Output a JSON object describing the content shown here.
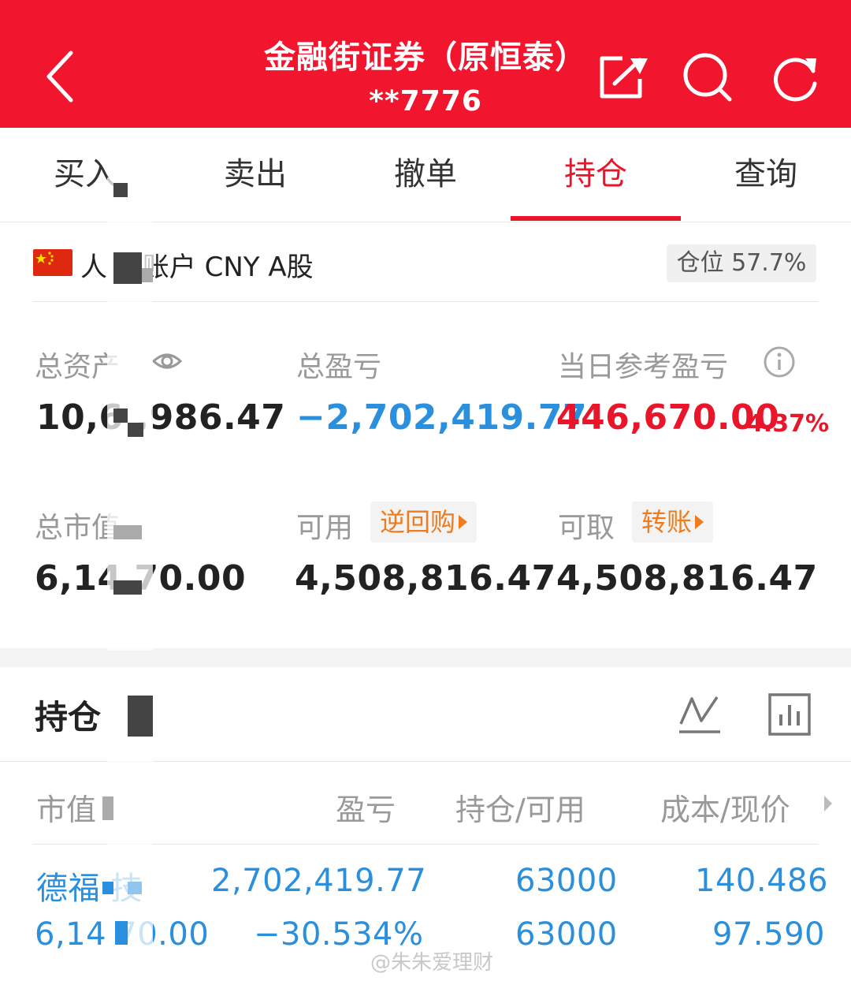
{
  "header": {
    "title": "金融街证券（原恒泰）",
    "account": "**7776"
  },
  "tabs": [
    {
      "label": "买入"
    },
    {
      "label": "卖出"
    },
    {
      "label": "撤单"
    },
    {
      "label": "持仓"
    },
    {
      "label": "查询"
    }
  ],
  "account_row": {
    "name": "人  币账户 CNY A股",
    "position_ratio": "仓位 57.7%"
  },
  "summary": {
    "total_assets_label": "总资产",
    "total_assets_value": "10,6  ,986.47",
    "total_pl_label": "总盈亏",
    "total_pl_value": "−2,702,419.77",
    "daily_pl_label": "当日参考盈亏",
    "daily_pl_value": "446,670.00",
    "daily_pl_pct": "4.37%",
    "market_value_label": "总市值",
    "market_value_value": "6,14  70.00",
    "available_label": "可用",
    "available_link": "逆回购",
    "available_value": "4,508,816.47",
    "withdrawable_label": "可取",
    "withdrawable_link": "转账",
    "withdrawable_value": "4,508,816.47"
  },
  "holdings": {
    "title": "持仓",
    "columns": [
      "市值",
      "盈亏",
      "持仓/可用",
      "成本/现价"
    ],
    "rows": [
      {
        "name": "德福  技",
        "market_value": "6,14  70.00",
        "pl": "2,702,419.77",
        "pl_pct": "−30.534%",
        "position": "63000",
        "available": "63000",
        "cost": "140.486",
        "price": "97.590"
      }
    ]
  },
  "watermark": "@朱朱爱理财",
  "colors": {
    "brand_red": "#f1152d",
    "accent_red": "#e8152b",
    "blue": "#2a8fdd",
    "orange": "#f07b1c"
  }
}
